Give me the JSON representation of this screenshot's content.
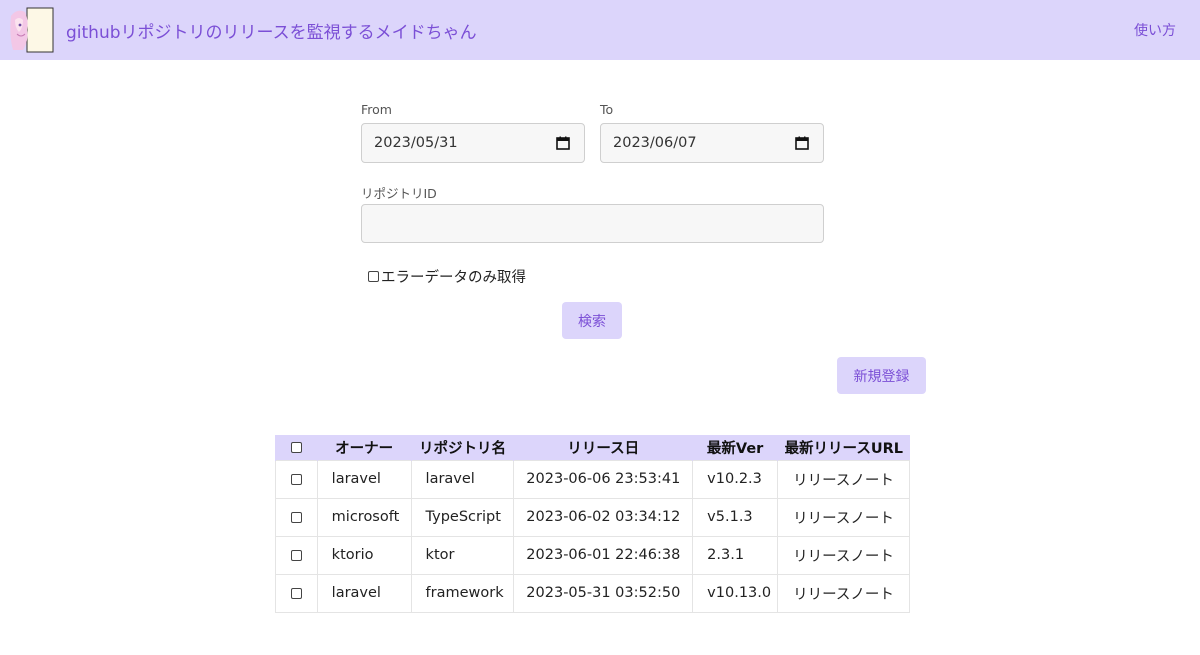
{
  "header": {
    "title": "githubリポジトリのリリースを監視するメイドちゃん",
    "usage_link": "使い方",
    "accent_color": "#dcd5fb",
    "text_color": "#7b4fd6"
  },
  "form": {
    "from_label": "From",
    "from_value": "2023/05/31",
    "to_label": "To",
    "to_value": "2023/06/07",
    "repo_id_label": "リポジトリID",
    "repo_id_value": "",
    "error_only_label": "エラーデータのみ取得",
    "search_button": "検索",
    "new_button": "新規登録"
  },
  "table": {
    "headers": [
      "オーナー",
      "リポジトリ名",
      "リリース日",
      "最新Ver",
      "最新リリースURL"
    ],
    "rows": [
      {
        "owner": "laravel",
        "repo": "laravel",
        "date": "2023-06-06 23:53:41",
        "ver": "v10.2.3",
        "url": "リリースノート"
      },
      {
        "owner": "microsoft",
        "repo": "TypeScript",
        "date": "2023-06-02 03:34:12",
        "ver": "v5.1.3",
        "url": "リリースノート"
      },
      {
        "owner": "ktorio",
        "repo": "ktor",
        "date": "2023-06-01 22:46:38",
        "ver": "2.3.1",
        "url": "リリースノート"
      },
      {
        "owner": "laravel",
        "repo": "framework",
        "date": "2023-05-31 03:52:50",
        "ver": "v10.13.0",
        "url": "リリースノート"
      }
    ]
  }
}
